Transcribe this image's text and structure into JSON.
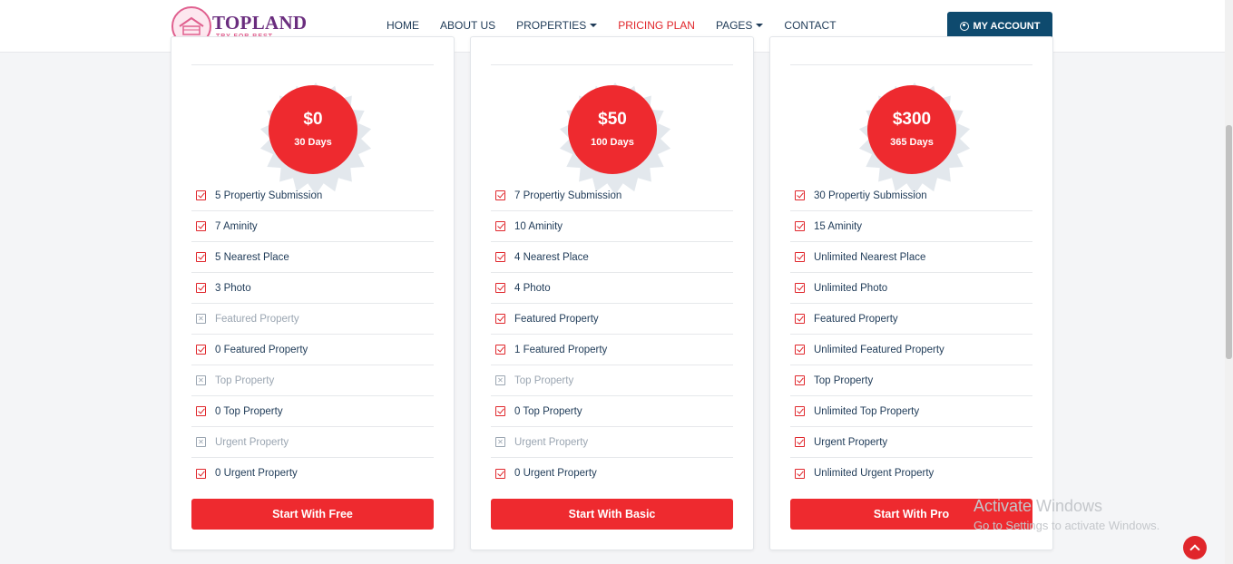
{
  "brand": {
    "name": "TOPLAND",
    "tagline": "TRY FOR BEST"
  },
  "nav": {
    "items": [
      {
        "label": "HOME",
        "dropdown": false,
        "active": false
      },
      {
        "label": "ABOUT US",
        "dropdown": false,
        "active": false
      },
      {
        "label": "PROPERTIES",
        "dropdown": true,
        "active": false
      },
      {
        "label": "PRICING PLAN",
        "dropdown": false,
        "active": true
      },
      {
        "label": "PAGES",
        "dropdown": true,
        "active": false
      },
      {
        "label": "CONTACT",
        "dropdown": false,
        "active": false
      }
    ],
    "account_label": "MY ACCOUNT"
  },
  "plans": [
    {
      "price": "$0",
      "duration": "30 Days",
      "button": "Start With Free",
      "features": [
        {
          "text": "5 Propertiy Submission",
          "included": true
        },
        {
          "text": "7 Aminity",
          "included": true
        },
        {
          "text": "5 Nearest Place",
          "included": true
        },
        {
          "text": "3 Photo",
          "included": true
        },
        {
          "text": "Featured Property",
          "included": false
        },
        {
          "text": "0 Featured Property",
          "included": true
        },
        {
          "text": "Top Property",
          "included": false
        },
        {
          "text": "0 Top Property",
          "included": true
        },
        {
          "text": "Urgent Property",
          "included": false
        },
        {
          "text": "0 Urgent Property",
          "included": true
        }
      ]
    },
    {
      "price": "$50",
      "duration": "100 Days",
      "button": "Start With Basic",
      "features": [
        {
          "text": "7 Propertiy Submission",
          "included": true
        },
        {
          "text": "10 Aminity",
          "included": true
        },
        {
          "text": "4 Nearest Place",
          "included": true
        },
        {
          "text": "4 Photo",
          "included": true
        },
        {
          "text": "Featured Property",
          "included": true
        },
        {
          "text": "1 Featured Property",
          "included": true
        },
        {
          "text": "Top Property",
          "included": false
        },
        {
          "text": "0 Top Property",
          "included": true
        },
        {
          "text": "Urgent Property",
          "included": false
        },
        {
          "text": "0 Urgent Property",
          "included": true
        }
      ]
    },
    {
      "price": "$300",
      "duration": "365 Days",
      "button": "Start With Pro",
      "features": [
        {
          "text": "30 Propertiy Submission",
          "included": true
        },
        {
          "text": "15 Aminity",
          "included": true
        },
        {
          "text": "Unlimited Nearest Place",
          "included": true
        },
        {
          "text": "Unlimited Photo",
          "included": true
        },
        {
          "text": "Featured Property",
          "included": true
        },
        {
          "text": "Unlimited Featured Property",
          "included": true
        },
        {
          "text": "Top Property",
          "included": true
        },
        {
          "text": "Unlimited Top Property",
          "included": true
        },
        {
          "text": "Urgent Property",
          "included": true
        },
        {
          "text": "Unlimited Urgent Property",
          "included": true
        }
      ]
    }
  ],
  "watermark": {
    "title": "Activate Windows",
    "subtitle": "Go to Settings to activate Windows."
  },
  "colors": {
    "accent": "#ee2a2f",
    "navy": "#0e4a6e",
    "text": "#1e3a57",
    "muted": "#9aa5b1"
  },
  "icons": {
    "included": "checkbox-checked-icon",
    "excluded": "checkbox-x-icon",
    "account": "user-circle-icon",
    "back_to_top": "chevron-up-icon"
  }
}
